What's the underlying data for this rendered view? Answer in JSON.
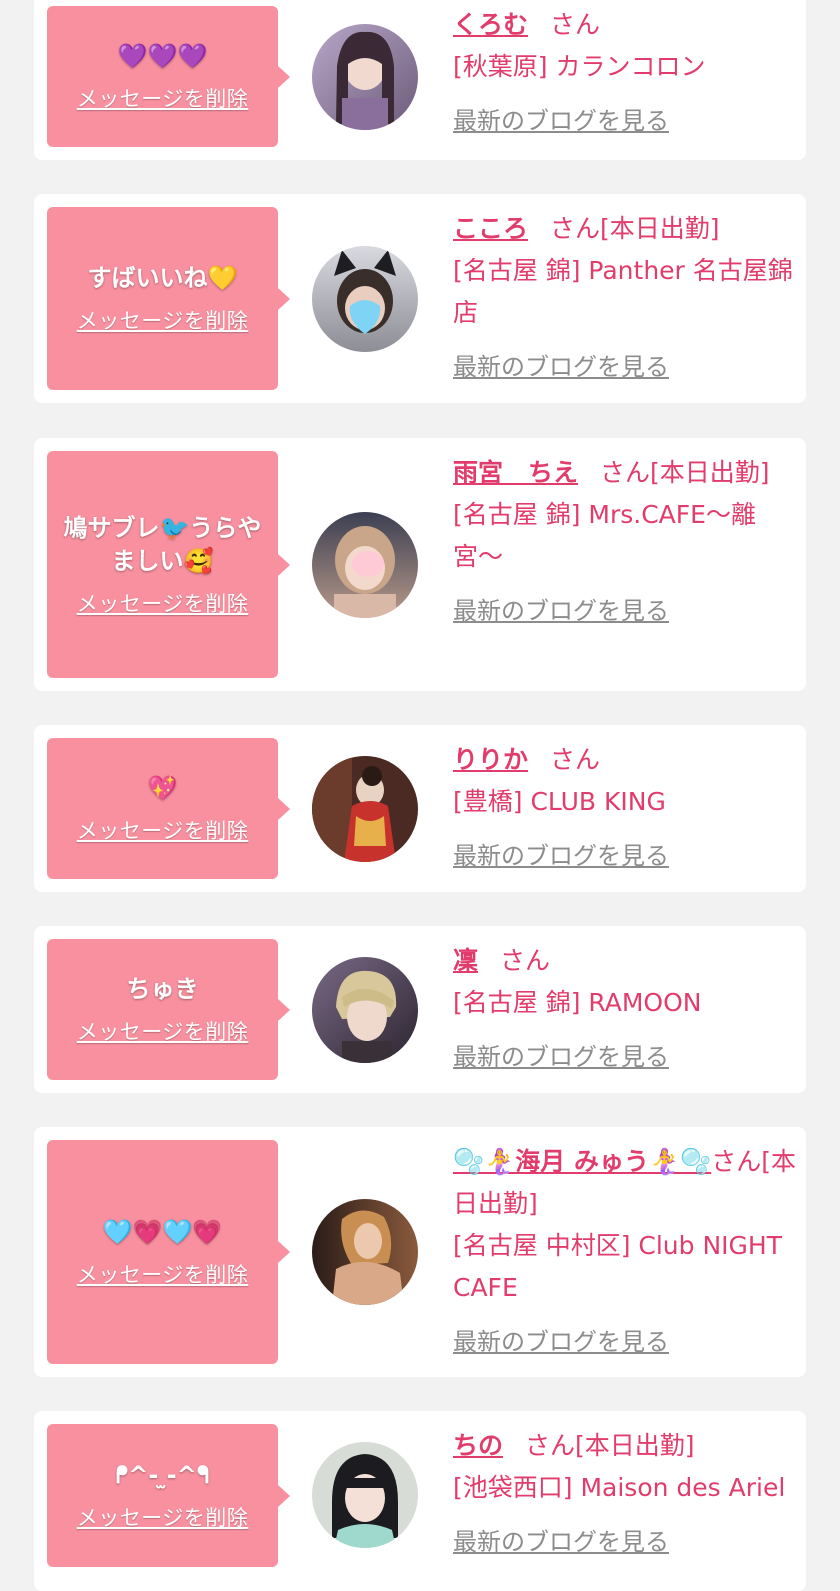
{
  "delete_label": "メッセージを削除",
  "san_label": "さん",
  "blog_label": "最新のブログを見る",
  "colors": {
    "accent_pink": "#e23c6c",
    "bubble_pink": "#f8909f",
    "link_gray": "#8c8c8c",
    "page_bg": "#f2f2f2"
  },
  "entries": [
    {
      "message": "💜💜💜",
      "name": "くろむ",
      "status": "",
      "shop": "[秋葉原] カランコロン"
    },
    {
      "message": "すばいいね💛",
      "name": "こころ",
      "status": "[本日出勤]",
      "shop": "[名古屋 錦] Panther 名古屋錦店"
    },
    {
      "message": "鳩サブレ🐦うらやましい🥰",
      "name": "雨宮　ちえ",
      "status": "[本日出勤]",
      "shop": "[名古屋 錦] Mrs.CAFE〜離宮〜"
    },
    {
      "message": "💖",
      "name": "りりか",
      "status": "",
      "shop": "[豊橋] CLUB KING"
    },
    {
      "message": "ちゅき",
      "name": "凜",
      "status": "",
      "shop": "[名古屋 錦] RAMOON"
    },
    {
      "message": "🩵💗🩵💗",
      "name": "🫧🧜‍♀️海月 みゅう🧜‍♀️🫧",
      "status": "[本日出勤]",
      "shop": "[名古屋 中村区] Club NIGHT CAFE"
    },
    {
      "message": "ᖰ^- ̫-^ᖳ",
      "name": "ちの",
      "status": "[本日出勤]",
      "shop": "[池袋西口] Maison des Ariel"
    }
  ]
}
